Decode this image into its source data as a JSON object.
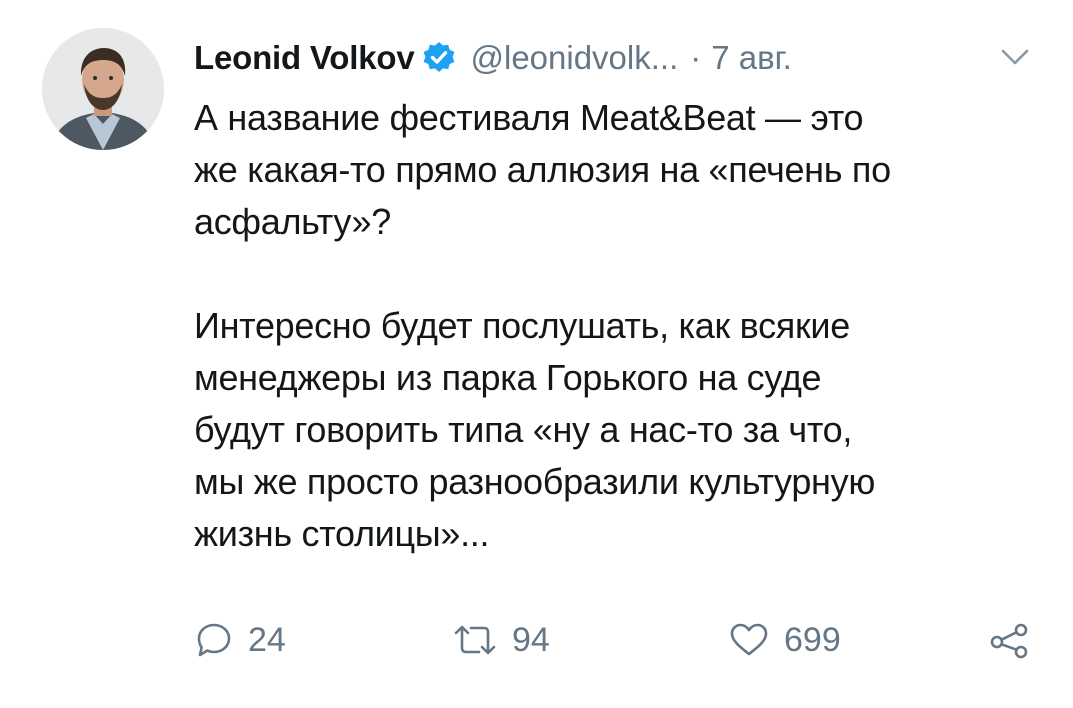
{
  "author": {
    "name": "Leonid Volkov",
    "handle": "@leonidvolk...",
    "separator": "·",
    "date": "7 авг.",
    "verified": true
  },
  "tweet": {
    "text": "А название фестиваля Meat&Beat — это\nже какая-то прямо аллюзия на «печень по\nасфальту»?\n\nИнтересно будет послушать, как всякие\nменеджеры из парка Горького на суде\nбудут говорить типа «ну а нас-то за что,\nмы же просто разнообразили культурную\nжизнь столицы»..."
  },
  "actions": {
    "reply_count": "24",
    "retweet_count": "94",
    "like_count": "699"
  },
  "icons": {
    "verified": "verified-badge-icon",
    "caret": "chevron-down-icon",
    "reply": "reply-icon",
    "retweet": "retweet-icon",
    "like": "heart-icon",
    "share": "share-icon"
  },
  "colors": {
    "verified_blue": "#1da1f2",
    "secondary_text": "#657786",
    "primary_text": "#14171a"
  }
}
